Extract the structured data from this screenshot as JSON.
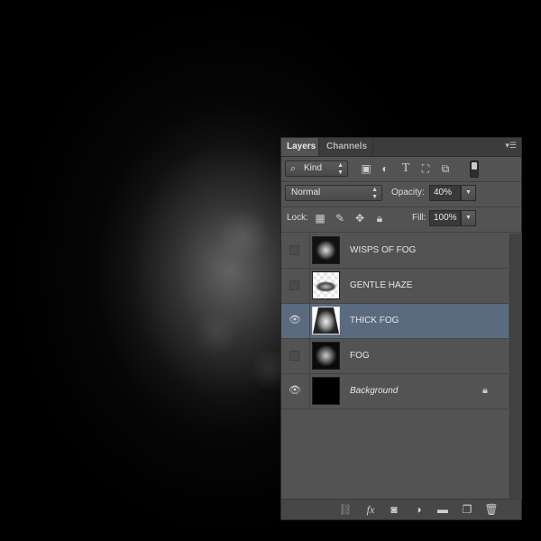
{
  "panel": {
    "tabs": [
      {
        "label": "Layers",
        "active": true
      },
      {
        "label": "Channels",
        "active": false
      }
    ],
    "menu_icon": "panel-menu-icon"
  },
  "filter": {
    "kind_label": "Kind",
    "icons": [
      "pixel-filter-icon",
      "adjustment-filter-icon",
      "type-filter-icon",
      "shape-filter-icon",
      "smart-object-filter-icon"
    ],
    "type_glyph": "T"
  },
  "blend": {
    "mode": "Normal",
    "opacity_label": "Opacity:",
    "opacity_value": "40%"
  },
  "lock": {
    "label": "Lock:",
    "fill_label": "Fill:",
    "fill_value": "100%"
  },
  "layers": [
    {
      "name": "WISPS OF FOG",
      "visible": false,
      "selected": false
    },
    {
      "name": "GENTLE HAZE",
      "visible": false,
      "selected": false
    },
    {
      "name": "THICK FOG",
      "visible": true,
      "selected": true
    },
    {
      "name": "FOG",
      "visible": false,
      "selected": false
    },
    {
      "name": "Background",
      "visible": true,
      "selected": false,
      "locked": true,
      "italic": true
    }
  ],
  "bottom_buttons": [
    "link-layers-icon",
    "fx-icon",
    "add-mask-icon",
    "new-adjustment-layer-icon",
    "new-group-icon",
    "new-layer-icon",
    "delete-layer-icon"
  ],
  "fx_label": "fx",
  "colors": {
    "panel_bg": "#535353",
    "selected_row": "#5a6b80",
    "canvas_bg": "#000000"
  }
}
